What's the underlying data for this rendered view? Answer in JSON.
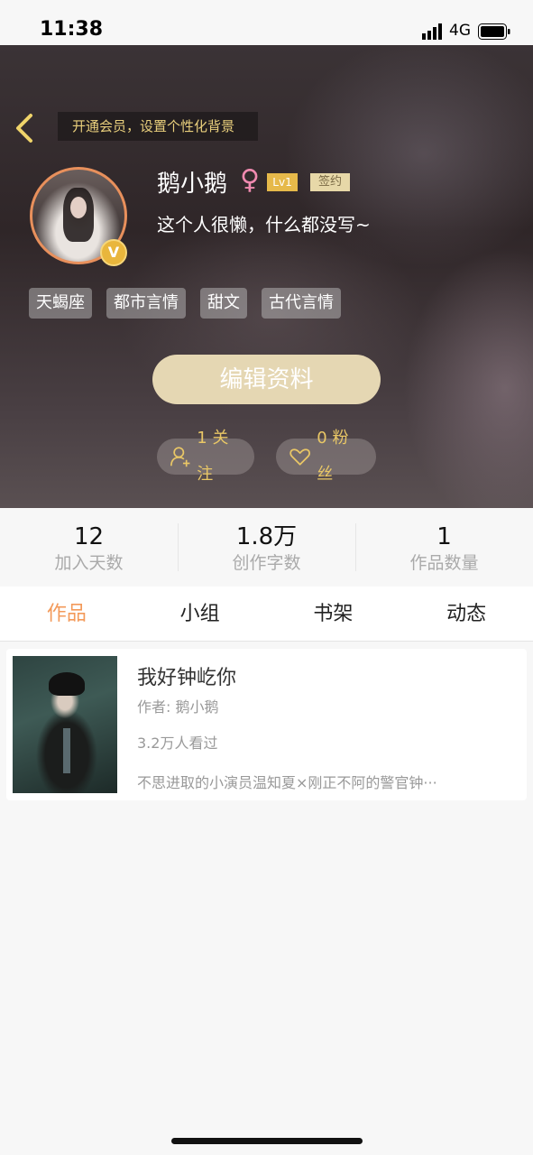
{
  "status_bar": {
    "time": "11:38",
    "network": "4G"
  },
  "header": {
    "vip_banner": "开通会员，设置个性化背景",
    "username": "鹅小鹅",
    "gender_symbol": "♀",
    "level": "Lv1",
    "contract_badge": "签约",
    "vip_badge": "V",
    "bio": "这个人很懒，什么都没写~",
    "tags": [
      "天蝎座",
      "都市言情",
      "甜文",
      "古代言情"
    ],
    "edit_button": "编辑资料",
    "follow_label": "1 关注",
    "fans_label": "0 粉丝"
  },
  "stats": [
    {
      "value": "12",
      "label": "加入天数"
    },
    {
      "value": "1.8万",
      "label": "创作字数"
    },
    {
      "value": "1",
      "label": "作品数量"
    }
  ],
  "tabs": [
    "作品",
    "小组",
    "书架",
    "动态"
  ],
  "active_tab": "作品",
  "works": [
    {
      "title": "我好钟屹你",
      "author": "作者: 鹅小鹅",
      "views": "3.2万人看过",
      "description": "不思进取的小演员温知夏×刚正不阿的警官钟···"
    }
  ],
  "colors": {
    "accent": "#f39a5a",
    "gold": "#e9c766",
    "edit_button": "#e5d7b3"
  }
}
